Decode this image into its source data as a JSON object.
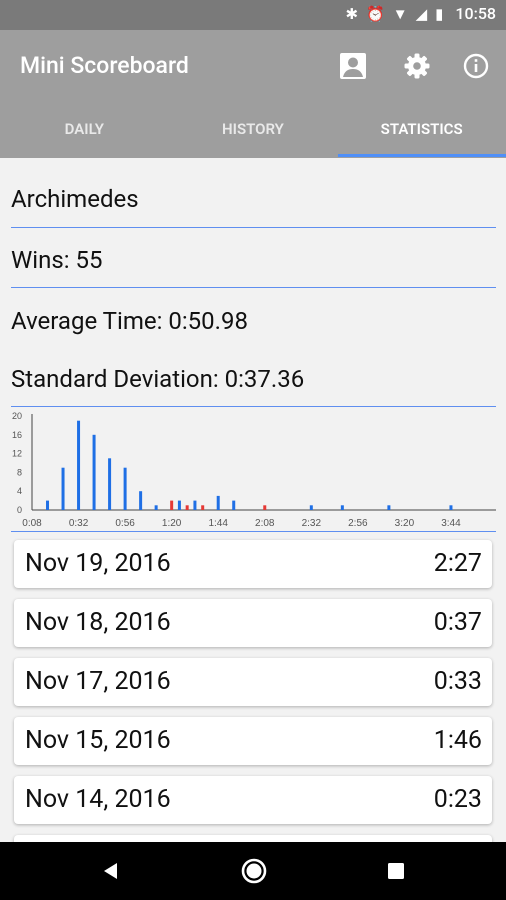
{
  "status": {
    "time": "10:58"
  },
  "app": {
    "title": "Mini Scoreboard"
  },
  "actions": [
    {
      "name": "account-icon"
    },
    {
      "name": "settings-icon"
    },
    {
      "name": "info-icon"
    }
  ],
  "tabs": [
    {
      "label": "DAILY",
      "active": false
    },
    {
      "label": "HISTORY",
      "active": false
    },
    {
      "label": "STATISTICS",
      "active": true
    }
  ],
  "stats": {
    "name": "Archimedes",
    "wins": "Wins: 55",
    "average": "Average Time: 0:50.98",
    "stddev": "Standard Deviation: 0:37.36"
  },
  "chart_data": {
    "type": "bar",
    "ylim": [
      0,
      20
    ],
    "yticks": [
      0,
      4,
      8,
      12,
      16,
      20
    ],
    "xtick_labels": [
      "0:08",
      "0:32",
      "0:56",
      "1:20",
      "1:44",
      "2:08",
      "2:32",
      "2:56",
      "3:20",
      "3:44"
    ],
    "x_unit": "seconds",
    "xlim": [
      8,
      240
    ],
    "colors": {
      "blue": "#1f6fe5",
      "red": "#e53935"
    },
    "bars": [
      {
        "x": 16,
        "y": 2,
        "color": "blue"
      },
      {
        "x": 24,
        "y": 9,
        "color": "blue"
      },
      {
        "x": 32,
        "y": 19,
        "color": "blue"
      },
      {
        "x": 40,
        "y": 16,
        "color": "blue"
      },
      {
        "x": 48,
        "y": 11,
        "color": "blue"
      },
      {
        "x": 56,
        "y": 9,
        "color": "blue"
      },
      {
        "x": 64,
        "y": 4,
        "color": "blue"
      },
      {
        "x": 72,
        "y": 1,
        "color": "blue"
      },
      {
        "x": 80,
        "y": 2,
        "color": "red"
      },
      {
        "x": 84,
        "y": 2,
        "color": "blue"
      },
      {
        "x": 88,
        "y": 1,
        "color": "red"
      },
      {
        "x": 92,
        "y": 2,
        "color": "blue"
      },
      {
        "x": 96,
        "y": 1,
        "color": "red"
      },
      {
        "x": 104,
        "y": 3,
        "color": "blue"
      },
      {
        "x": 112,
        "y": 2,
        "color": "blue"
      },
      {
        "x": 128,
        "y": 1,
        "color": "red"
      },
      {
        "x": 152,
        "y": 1,
        "color": "blue"
      },
      {
        "x": 168,
        "y": 1,
        "color": "blue"
      },
      {
        "x": 192,
        "y": 1,
        "color": "blue"
      },
      {
        "x": 224,
        "y": 1,
        "color": "blue"
      }
    ]
  },
  "history": [
    {
      "date": "Nov 19, 2016",
      "time": "2:27"
    },
    {
      "date": "Nov 18, 2016",
      "time": "0:37"
    },
    {
      "date": "Nov 17, 2016",
      "time": "0:33"
    },
    {
      "date": "Nov 15, 2016",
      "time": "1:46"
    },
    {
      "date": "Nov 14, 2016",
      "time": "0:23"
    }
  ]
}
